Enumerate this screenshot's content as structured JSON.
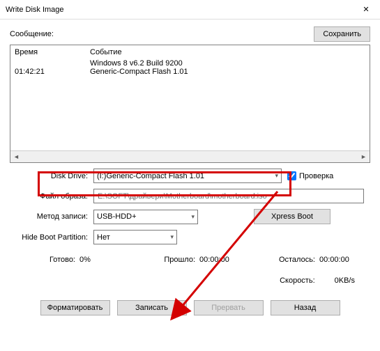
{
  "window": {
    "title": "Write Disk Image"
  },
  "message": {
    "label": "Сообщение:",
    "save_btn": "Сохранить"
  },
  "log": {
    "col_time": "Время",
    "col_event": "Событие",
    "rows": [
      {
        "time": "",
        "event": "Windows 8 v6.2 Build 9200"
      },
      {
        "time": "01:42:21",
        "event": "Generic-Compact Flash   1.01"
      }
    ]
  },
  "form": {
    "drive_label": "Disk Drive:",
    "drive_value": "(I:)Generic-Compact Flash   1.01",
    "verify_label": "Проверка",
    "image_label": "Файл образа:",
    "image_value": "E:\\SOFT\\драйвери\\Motherboard\\motherboard.iso",
    "method_label": "Метод записи:",
    "method_value": "USB-HDD+",
    "xpress_btn": "Xpress Boot",
    "hide_label": "Hide Boot Partition:",
    "hide_value": "Нет"
  },
  "status": {
    "ready_label": "Готово:",
    "ready_val": "0%",
    "elapsed_label": "Прошло:",
    "elapsed_val": "00:00:00",
    "remain_label": "Осталось:",
    "remain_val": "00:00:00",
    "speed_label": "Скорость:",
    "speed_val": "0KB/s"
  },
  "buttons": {
    "format": "Форматировать",
    "write": "Записать",
    "abort": "Прервать",
    "back": "Назад"
  }
}
